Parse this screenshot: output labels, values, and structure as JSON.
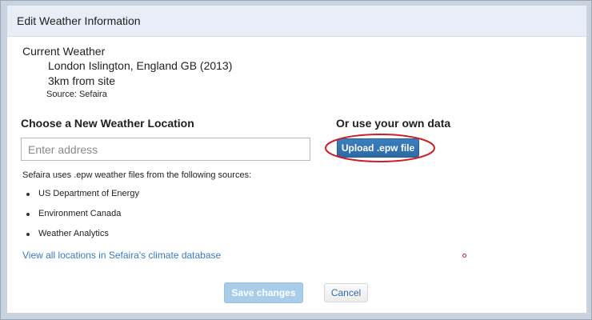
{
  "dialog": {
    "title": "Edit Weather Information"
  },
  "current_weather": {
    "heading": "Current Weather",
    "location": "London Islington, England GB (2013)",
    "distance": "3km from site",
    "source": "Source: Sefaira"
  },
  "new_location": {
    "heading": "Choose a New Weather Location",
    "address_placeholder": "Enter address",
    "address_value": ""
  },
  "own_data": {
    "heading": "Or use your own data",
    "upload_label": "Upload .epw file"
  },
  "sources": {
    "intro": "Sefaira uses .epw weather files from the following sources:",
    "items": [
      "US Department of Energy",
      "Environment Canada",
      "Weather Analytics"
    ],
    "link_label": "View all locations in Sefaira's climate database"
  },
  "footer": {
    "save_label": "Save changes",
    "cancel_label": "Cancel"
  },
  "colors": {
    "accent": "#2d6aa5",
    "link": "#3a7cc0",
    "highlight": "#cc1f2a",
    "disabled_button": "#a9cde9"
  }
}
